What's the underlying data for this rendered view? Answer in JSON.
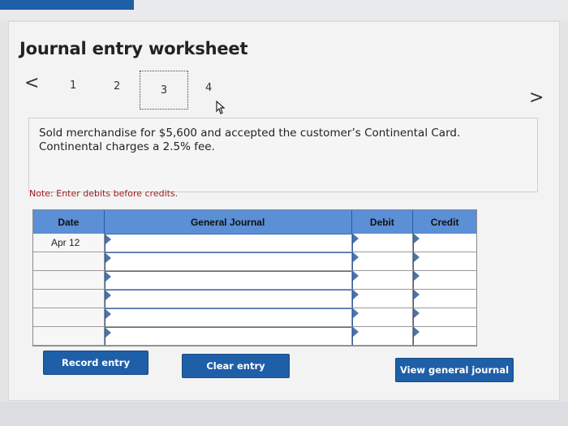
{
  "header": {
    "title": "Journal entry worksheet"
  },
  "pagination": {
    "prev_label": "<",
    "next_label": ">",
    "pages": [
      "1",
      "2",
      "3",
      "4"
    ],
    "current": "3"
  },
  "question": {
    "line1": "Sold merchandise for $5,600 and accepted the customer’s Continental Card.",
    "line2": "Continental charges a 2.5% fee."
  },
  "note": "Note: Enter debits before credits.",
  "journal": {
    "headers": {
      "date": "Date",
      "general_journal": "General Journal",
      "debit": "Debit",
      "credit": "Credit"
    },
    "rows": [
      {
        "date": "Apr 12",
        "account": "",
        "debit": "",
        "credit": ""
      },
      {
        "date": "",
        "account": "",
        "debit": "",
        "credit": ""
      },
      {
        "date": "",
        "account": "",
        "debit": "",
        "credit": ""
      },
      {
        "date": "",
        "account": "",
        "debit": "",
        "credit": ""
      },
      {
        "date": "",
        "account": "",
        "debit": "",
        "credit": ""
      },
      {
        "date": "",
        "account": "",
        "debit": "",
        "credit": ""
      }
    ]
  },
  "buttons": {
    "record": "Record entry",
    "clear": "Clear entry",
    "view": "View general journal"
  },
  "colors": {
    "accent": "#1f5fa8",
    "header_blue": "#5b8fd6",
    "note_red": "#a11d1d"
  }
}
